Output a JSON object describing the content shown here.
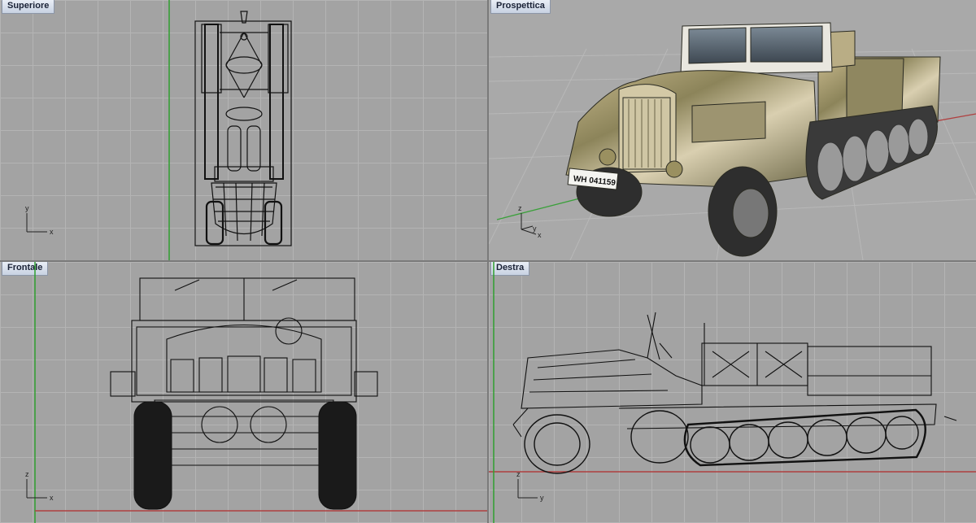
{
  "viewports": [
    {
      "id": "top",
      "title": "Superiore",
      "axes": {
        "horizontal": "x",
        "vertical": "y"
      }
    },
    {
      "id": "perspective",
      "title": "Prospettica",
      "axes": {
        "a": "z",
        "b": "y",
        "c": "x"
      },
      "plate": "WH 041159"
    },
    {
      "id": "front",
      "title": "Frontale",
      "axes": {
        "horizontal": "x",
        "vertical": "z"
      }
    },
    {
      "id": "right",
      "title": "Destra",
      "axes": {
        "horizontal": "y",
        "vertical": "z"
      }
    }
  ],
  "colors": {
    "x_axis": "#b04040",
    "y_axis": "#3aa03a",
    "wire": "#111111",
    "viewport_bg": "#a3a3a3",
    "border": "#6e6e6e"
  }
}
